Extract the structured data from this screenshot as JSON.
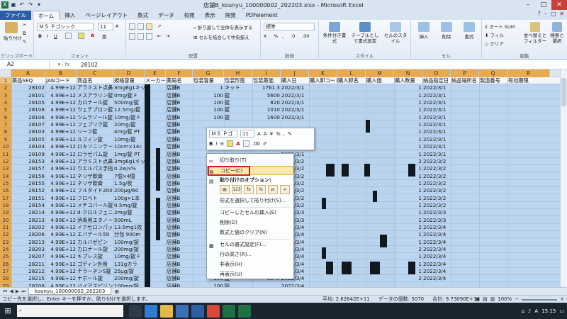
{
  "window": {
    "title": "店舗B_kounyu_100000002_202203.xlsx - Microsoft Excel"
  },
  "tabs": [
    {
      "label": "ファイル"
    },
    {
      "label": "ホーム"
    },
    {
      "label": "挿入"
    },
    {
      "label": "ページレイアウト"
    },
    {
      "label": "数式"
    },
    {
      "label": "データ"
    },
    {
      "label": "校閲"
    },
    {
      "label": "表示"
    },
    {
      "label": "開発"
    },
    {
      "label": "PDFelement"
    }
  ],
  "ribbon": {
    "clipboard_label": "クリップボード",
    "paste_label": "貼り付け",
    "font_label": "フォント",
    "font_name": "ＭＳ Ｐゴシック",
    "font_size": "11",
    "align_label": "配置",
    "wrap_text": "折り返して全体を表示する",
    "merge_center": "セルを結合して中央揃え",
    "number_label": "数値",
    "number_format": "標準",
    "style_label": "スタイル",
    "conditional_format": "条件付き書式",
    "table_format": "テーブルとして書式設定",
    "cell_style": "セルのスタイル",
    "cells_label": "セル",
    "insert": "挿入",
    "delete": "削除",
    "format": "書式",
    "edit_label": "編集",
    "autosum": "オート SUM",
    "fill": "フィル",
    "clear": "クリア",
    "sort_filter": "並べ替えとフィルター",
    "find_select": "検索と選択"
  },
  "formula_bar": {
    "cell_ref": "A2",
    "value": "28102"
  },
  "columns": [
    "A",
    "B",
    "C",
    "D",
    "E",
    "F",
    "G",
    "H",
    "I",
    "J",
    "K",
    "L",
    "M",
    "N",
    "O",
    "P",
    "Q",
    "R"
  ],
  "header_row": [
    "薬品SEQ",
    "JANコード",
    "商品名",
    "規格容量",
    "メーカー名",
    "薬局名",
    "包装容量",
    "包装形態",
    "包装薬価",
    "購入日",
    "購入卸コード",
    "購入卸名",
    "購入価",
    "購入数量",
    "納品指定日",
    "納品場所名",
    "製造番号",
    "有効期限"
  ],
  "rows": [
    {
      "n": "2",
      "a": "28102",
      "b": "4.99E+12",
      "c": "アラミスト点鼻",
      "d": "3mg6g1キット",
      "f": "店舗B",
      "g": "1",
      "h": "キット",
      "i": "1761.3",
      "j": "2022/3/1",
      "n2": "1",
      "o": "2022/3/1"
    },
    {
      "n": "3",
      "a": "28101",
      "b": "4.99E+12",
      "c": "メスアラリン錠1",
      "d": "0mg/錠 F",
      "f": "店舗B",
      "g": "100",
      "h": "錠",
      "i": "5600",
      "j": "2022/3/1",
      "n2": "1",
      "o": "2022/3/1"
    },
    {
      "n": "4",
      "a": "28105",
      "b": "4.99E+12",
      "c": "カロナール錠",
      "d": "500mg/錠",
      "f": "店舗B",
      "g": "100",
      "h": "錠",
      "i": "820",
      "j": "2022/3/1",
      "n2": "1",
      "o": "2022/3/1"
    },
    {
      "n": "5",
      "a": "28108",
      "b": "4.99E+12",
      "c": "ウェチプロン錠",
      "d": "12.5mg/錠",
      "f": "店舗B",
      "g": "100",
      "h": "錠",
      "i": "1010",
      "j": "2022/3/1",
      "n2": "1",
      "o": "2022/3/1"
    },
    {
      "n": "6",
      "a": "28106",
      "b": "4.99E+12",
      "c": "ツムラゾール錠",
      "d": "10mg/錠 F",
      "f": "店舗B",
      "g": "100",
      "h": "錠",
      "i": "1600",
      "j": "2022/3/1",
      "n2": "1",
      "o": "2022/3/1"
    },
    {
      "n": "7",
      "a": "28107",
      "b": "4.99E+12",
      "c": "フェブリク錠",
      "d": "20mg/錠",
      "f": "店舗B",
      "g": "",
      "h": "",
      "i": "",
      "j": "",
      "n2": "1",
      "o": "2022/3/1"
    },
    {
      "n": "8",
      "a": "28103",
      "b": "4.99E+12",
      "c": "リーフ錠",
      "d": "4mg/錠 PT",
      "f": "店舗B",
      "g": "",
      "h": "",
      "i": "",
      "j": "",
      "n2": "1",
      "o": "2022/3/1"
    },
    {
      "n": "9",
      "a": "28105",
      "b": "4.99E+12",
      "c": "ルフィン錠",
      "d": "10mg/錠",
      "f": "店舗B",
      "g": "",
      "h": "",
      "i": "",
      "j": "",
      "n2": "1",
      "o": "2022/3/1"
    },
    {
      "n": "10",
      "a": "28104",
      "b": "4.99E+12",
      "c": "ロキソニンテープ",
      "d": "10cm×14c",
      "f": "店舗B",
      "g": "70",
      "h": "枚",
      "i": "1967",
      "j": "2022/3/1",
      "n2": "1",
      "o": "2022/3/1"
    },
    {
      "n": "11",
      "a": "28109",
      "b": "4.99E+12",
      "c": "ロラゼパム錠",
      "d": "1mg/錠 PT",
      "f": "店舗B",
      "g": "",
      "h": "",
      "i": "",
      "j": "2022/3/1",
      "n2": "1",
      "o": "2022/3/1"
    },
    {
      "n": "12",
      "a": "28153",
      "b": "4.99E+12",
      "c": "アラミスト点鼻",
      "d": "3mg6g1キット",
      "f": "店舗B",
      "g": "",
      "h": "",
      "i": "",
      "j": "2022/3/2",
      "n2": "2",
      "o": "2022/3/2"
    },
    {
      "n": "13",
      "a": "28157",
      "b": "4.99E+12",
      "c": "ウエルパス手指",
      "d": "0.2w/v%",
      "f": "店舗B",
      "g": "",
      "h": "",
      "i": "",
      "j": "2022/3/2",
      "n2": "1",
      "o": "2022/3/2"
    },
    {
      "n": "14",
      "a": "28156",
      "b": "4.99E+12",
      "c": "ネリザ軟膏",
      "d": "7個×4個",
      "f": "店舗B",
      "g": "",
      "h": "",
      "i": "",
      "j": "2022/3/2",
      "n2": "1",
      "o": "2022/3/2"
    },
    {
      "n": "15",
      "a": "28155",
      "b": "4.99E+12",
      "c": "ネリザ軟膏",
      "d": "1.5g/枚",
      "f": "店舗B",
      "g": "",
      "h": "",
      "i": "",
      "j": "2022/3/2",
      "n2": "1",
      "o": "2022/3/2"
    },
    {
      "n": "16",
      "a": "28152",
      "b": "4.99E+12",
      "c": "フルタイド200",
      "d": "200μg/60",
      "f": "店舗B",
      "g": "",
      "h": "",
      "i": "",
      "j": "2022/3/2",
      "n2": "1",
      "o": "2022/3/2"
    },
    {
      "n": "17",
      "a": "28151",
      "b": "4.99E+12",
      "c": "フロベト",
      "d": "100g×1本",
      "f": "店舗B",
      "g": "",
      "h": "",
      "i": "",
      "j": "2022/3/2",
      "n2": "1",
      "o": "2022/3/2"
    },
    {
      "n": "18",
      "a": "28154",
      "b": "4.99E+12",
      "c": "メチコバール錠",
      "d": "0.5mg/錠",
      "f": "店舗B",
      "g": "",
      "h": "",
      "i": "",
      "j": "2022/3/2",
      "n2": "1",
      "o": "2022/3/2"
    },
    {
      "n": "19",
      "a": "28214",
      "b": "4.99E+12",
      "c": "d-クロルフェニラ",
      "d": "2mg/錠",
      "f": "店舗B",
      "g": "",
      "h": "",
      "i": "",
      "j": "2022/3/3",
      "n2": "1",
      "o": "2022/3/3"
    },
    {
      "n": "20",
      "a": "28213",
      "b": "4.99E+12",
      "c": "消毒用エタノール",
      "d": "500mL",
      "f": "店舗B",
      "g": "",
      "h": "",
      "i": "",
      "j": "2022/3/3",
      "n2": "1",
      "o": "2022/3/3"
    },
    {
      "n": "21",
      "a": "28202",
      "b": "4.99E+12",
      "c": "イクセロンパッチ",
      "d": "13.5mg1枚",
      "f": "店舗B",
      "g": "",
      "h": "",
      "i": "",
      "j": "2022/3/4",
      "n2": "2",
      "o": "2022/3/4"
    },
    {
      "n": "22",
      "a": "28206",
      "b": "4.99E+12",
      "c": "エバデール59",
      "d": "分包 900m",
      "f": "店舗B",
      "g": "",
      "h": "",
      "i": "",
      "j": "2022/3/4",
      "n2": "1",
      "o": "2022/3/4"
    },
    {
      "n": "23",
      "a": "28213",
      "b": "4.99E+12",
      "c": "カルバゼピン",
      "d": "100mg/錠",
      "f": "店舗B",
      "g": "",
      "h": "",
      "i": "",
      "j": "2022/3/4",
      "n2": "1",
      "o": "2022/3/4"
    },
    {
      "n": "24",
      "a": "28203",
      "b": "4.99E+12",
      "c": "カロナール錠",
      "d": "200mg/錠",
      "f": "店舗B",
      "g": "",
      "h": "",
      "i": "",
      "j": "2022/3/4",
      "n2": "2",
      "o": "2022/3/4"
    },
    {
      "n": "25",
      "a": "28207",
      "b": "4.99E+12",
      "c": "キプレス錠",
      "d": "10mg/錠 F",
      "f": "店舗B",
      "g": "",
      "h": "",
      "i": "",
      "j": "2022/3/4",
      "n2": "1",
      "o": "2022/3/4"
    },
    {
      "n": "26",
      "a": "28211",
      "b": "4.99E+12",
      "c": "ゴディン外用",
      "d": "131gカラ",
      "f": "店舗B",
      "g": "",
      "h": "",
      "i": "",
      "j": "2022/3/4",
      "n2": "1",
      "o": "2022/3/4"
    },
    {
      "n": "27",
      "a": "28212",
      "b": "4.99E+12",
      "c": "チラーヂンS錠",
      "d": "25μg/錠",
      "f": "店舗B",
      "g": "",
      "h": "",
      "i": "",
      "j": "2022/3/4",
      "n2": "1",
      "o": "2022/3/4"
    },
    {
      "n": "28",
      "a": "28215",
      "b": "4.99E+12",
      "c": "ナボール錠",
      "d": "200mg/錠",
      "f": "店舗B",
      "g": "100",
      "h": "錠",
      "i": "1340",
      "j": "2022/3/4",
      "n2": "2",
      "o": "2022/3/4"
    },
    {
      "n": "29",
      "a": "28208",
      "b": "4.99E+12",
      "c": "バイアスピリン",
      "d": "100mg/錠",
      "f": "店舗B",
      "g": "100",
      "h": "錠",
      "i": "",
      "j": "2022/3/4",
      "n2": "",
      "o": ""
    }
  ],
  "sheet_tab": "kounyu_100000002_202203",
  "status": {
    "message": "コピー先を選択し、Enter キーを押すか、貼り付けを選択します。",
    "average": "平均: 2.62642E+11",
    "count": "データの個数: 5070",
    "sum": "合計: 9.73090E+14",
    "zoom": "100%"
  },
  "mini_toolbar": {
    "font_name": "ＭＳ Ｐゴ",
    "font_size": "11"
  },
  "context_menu": {
    "cut": "切り取り(T)",
    "copy": "コピー(C)",
    "paste_options": "貼り付けのオプション:",
    "paste_special": "形式を選択して貼り付け(S)...",
    "insert_copied": "コピーしたセルの挿入(E)",
    "delete": "削除(D)",
    "clear_contents": "数式と値のクリア(N)",
    "format_cells": "セルの書式設定(F)...",
    "row_height": "行の高さ(R)...",
    "hide": "非表示(H)",
    "unhide": "再表示(U)"
  },
  "taskbar": {
    "time": "15:15"
  },
  "colors": {
    "accent": "#2a5fa8",
    "selection": "#bcd6f2",
    "header_active": "#e9a94f",
    "highlight_box": "#d02020"
  }
}
